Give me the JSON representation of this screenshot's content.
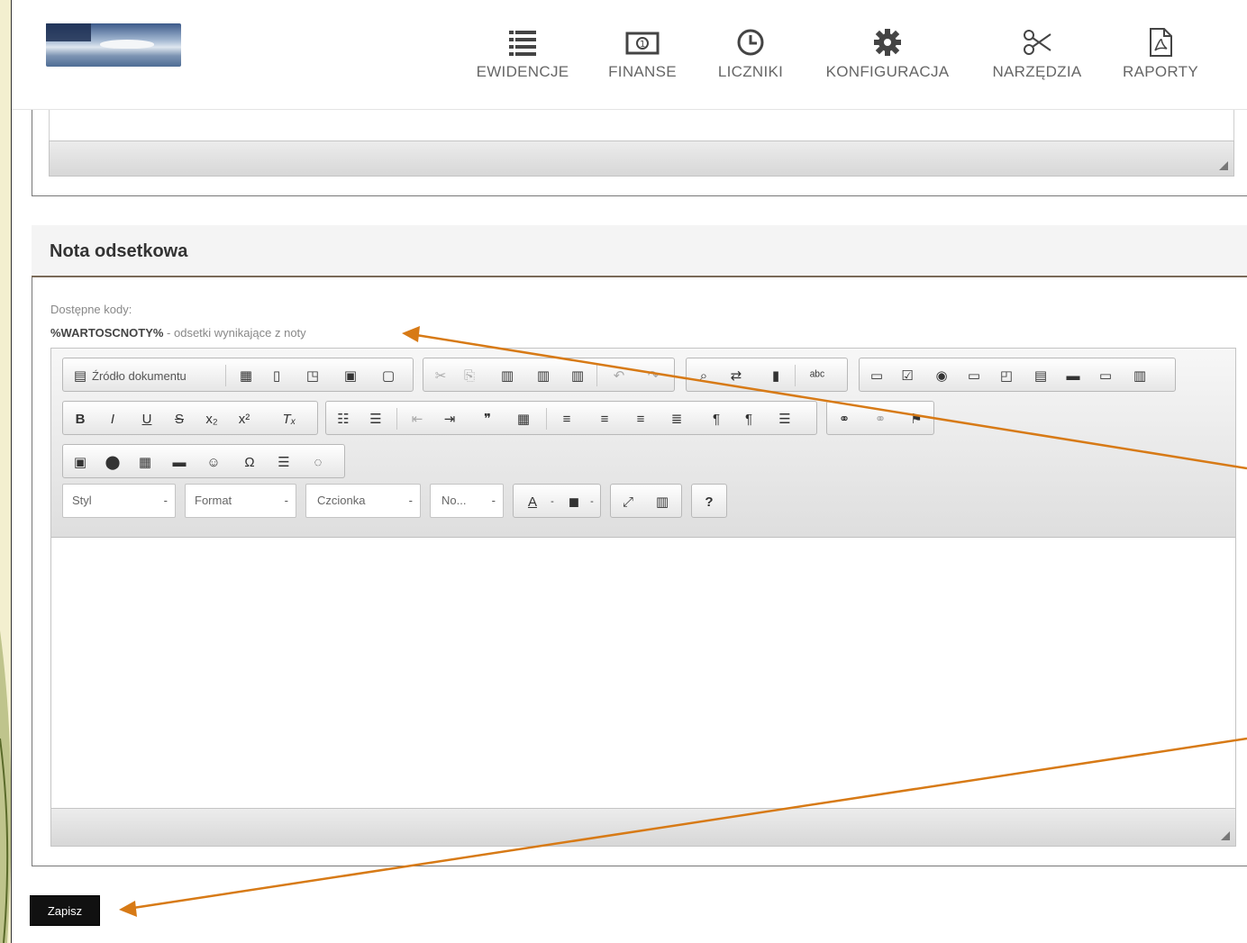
{
  "nav": [
    {
      "label": "EWIDENCJE",
      "icon": "list-icon"
    },
    {
      "label": "FINANSE",
      "icon": "money-icon"
    },
    {
      "label": "LICZNIKI",
      "icon": "clock-icon"
    },
    {
      "label": "KONFIGURACJA",
      "icon": "gear-icon"
    },
    {
      "label": "NARZĘDZIA",
      "icon": "scissors-icon"
    },
    {
      "label": "RAPORTY",
      "icon": "pdf-icon"
    }
  ],
  "section": {
    "title": "Nota odsetkowa",
    "codes_label": "Dostępne kody:",
    "code": "%WARTOSCNOTY%",
    "code_desc": " - odsetki wynikające z noty"
  },
  "toolbar": {
    "source_label": "Źródło dokumentu",
    "style_label": "Styl",
    "format_label": "Format",
    "font_label": "Czcionka",
    "size_label": "No...",
    "help_label": "?",
    "row2": [
      "B",
      "I",
      "U",
      "S",
      "x₂",
      "x²",
      "Tₓ"
    ]
  },
  "save_button": "Zapisz",
  "colors": {
    "background": "#f3efcf",
    "arrow": "#d77a16",
    "section_border": "#7a6a58"
  }
}
